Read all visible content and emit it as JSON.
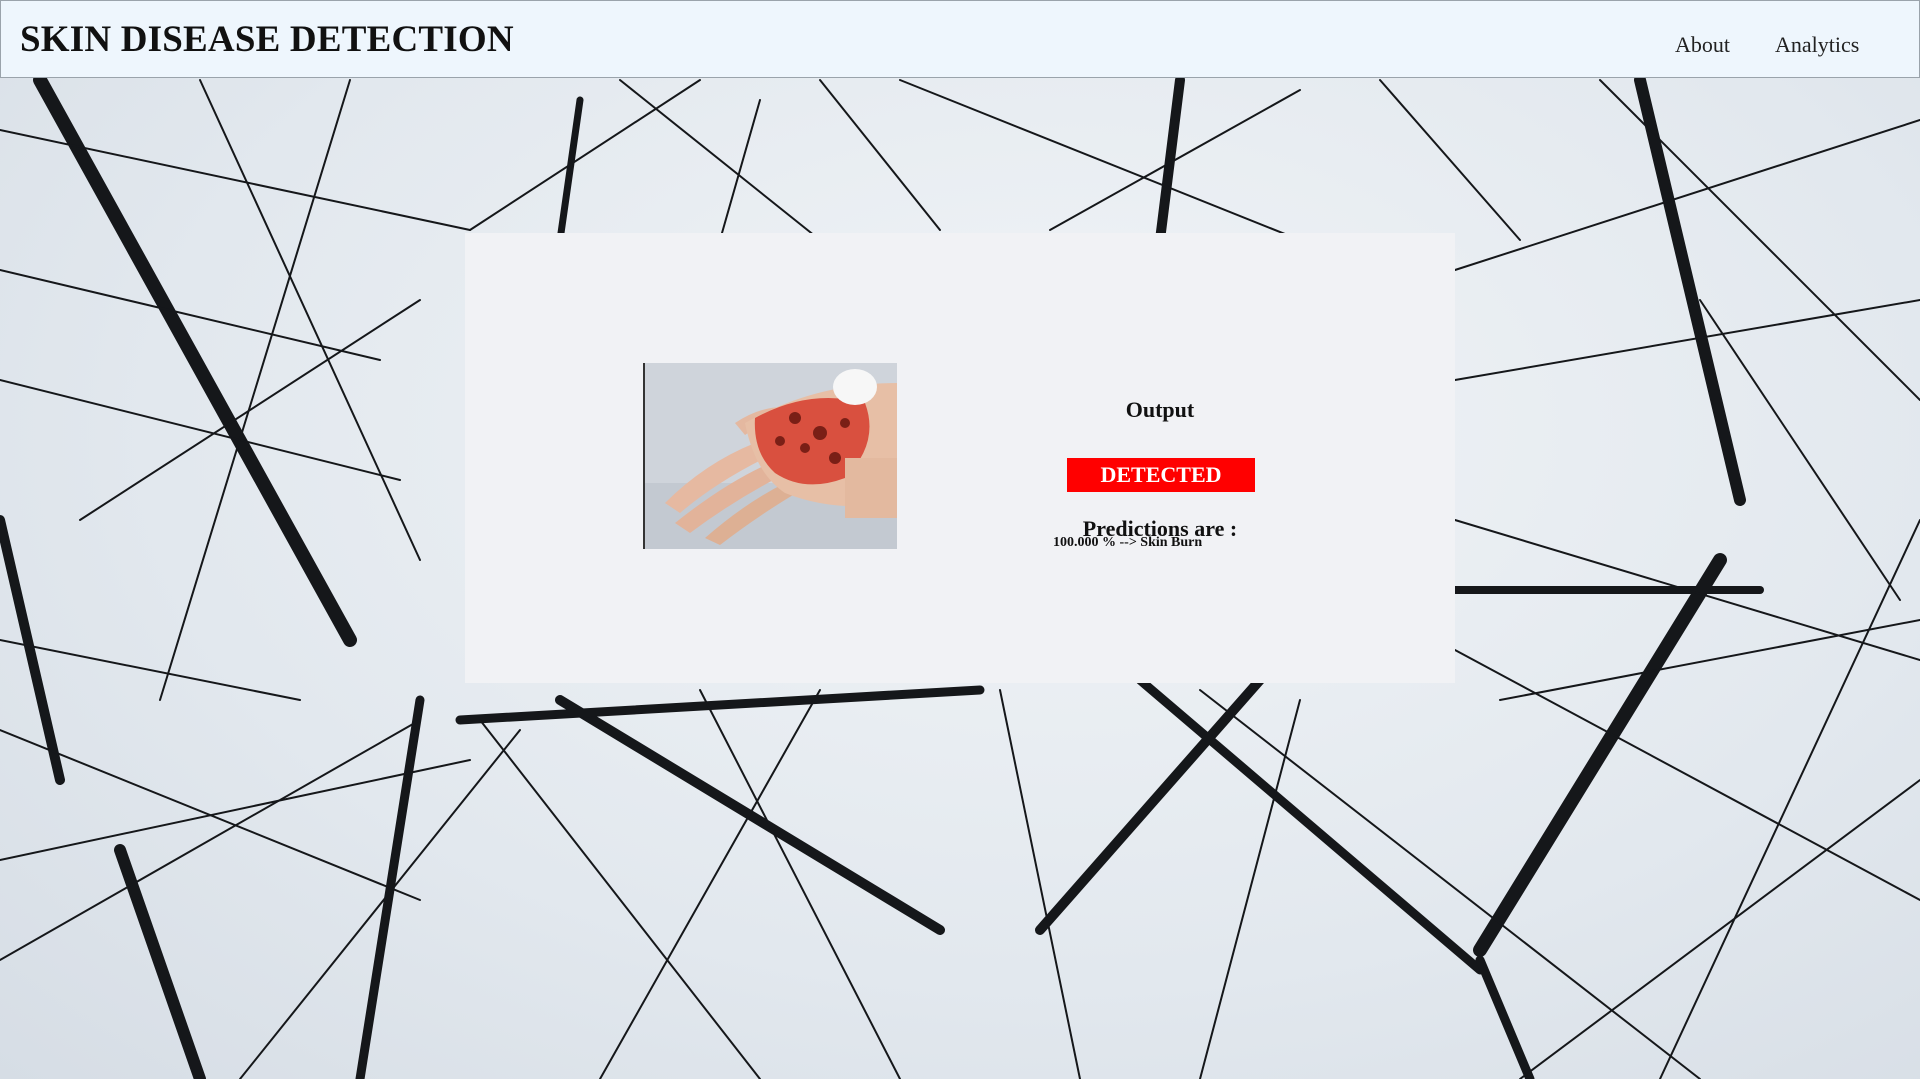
{
  "navbar": {
    "brand": "SKIN DISEASE DETECTION",
    "links": [
      "About",
      "Analytics"
    ]
  },
  "result": {
    "output_title": "Output",
    "status": "DETECTED",
    "status_color": "#ff0000",
    "predictions_title": "Predictions are :",
    "prediction_line": "100.000 % --> Skin Burn"
  },
  "colors": {
    "navbar_bg": "#eef6fd",
    "panel_bg": "#f1f2f5",
    "background": "#e6ebf0"
  }
}
